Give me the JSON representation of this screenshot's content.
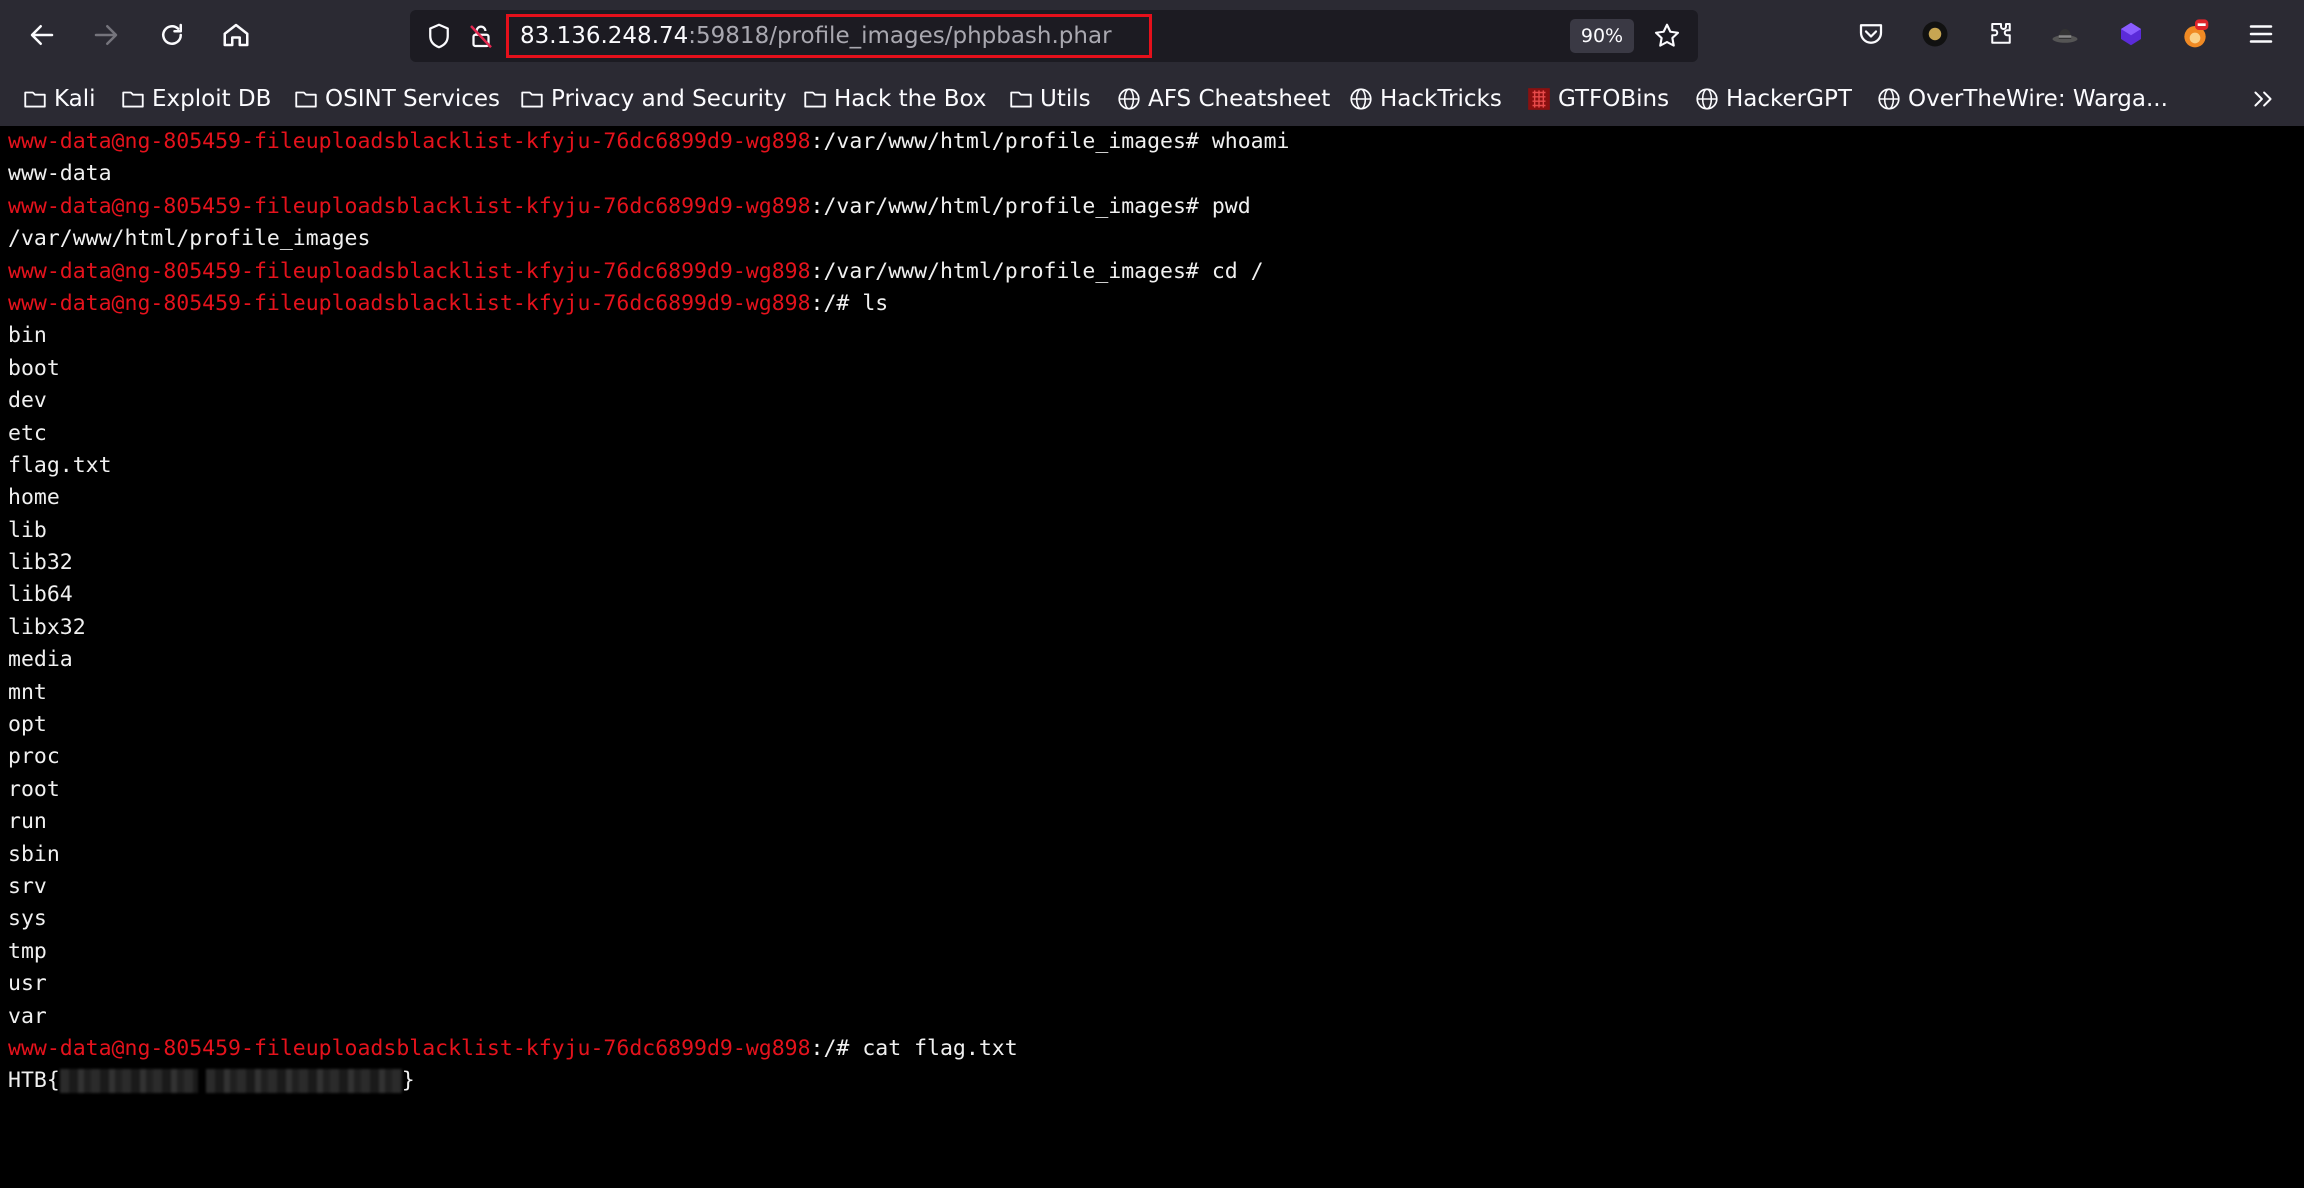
{
  "browser": {
    "url_host": "83.136.248.74",
    "url_rest": ":59818/profile_images/phpbash.phar",
    "zoom": "90%"
  },
  "bookmarks": [
    {
      "label": "Kali",
      "icon": "folder-icon"
    },
    {
      "label": "Exploit DB",
      "icon": "folder-icon"
    },
    {
      "label": "OSINT Services",
      "icon": "folder-icon"
    },
    {
      "label": "Privacy and Security",
      "icon": "folder-icon"
    },
    {
      "label": "Hack the Box",
      "icon": "folder-icon"
    },
    {
      "label": "Utils",
      "icon": "folder-icon"
    },
    {
      "label": "AFS Cheatsheet",
      "icon": "globe-icon"
    },
    {
      "label": "HackTricks",
      "icon": "globe-icon"
    },
    {
      "label": "GTFOBins",
      "icon": "gtfobins-icon"
    },
    {
      "label": "HackerGPT",
      "icon": "globe-icon"
    },
    {
      "label": "OverTheWire: Warga...",
      "icon": "globe-icon"
    }
  ],
  "terminal": {
    "prompt_user": "www-data@ng-805459-fileuploadsblacklist-kfyju-76dc6899d9-wg898",
    "lines": [
      {
        "type": "prompt",
        "path": ":/var/www/html/profile_images# ",
        "cmd": "whoami"
      },
      {
        "type": "output",
        "text": "www-data"
      },
      {
        "type": "prompt",
        "path": ":/var/www/html/profile_images# ",
        "cmd": "pwd"
      },
      {
        "type": "output",
        "text": "/var/www/html/profile_images"
      },
      {
        "type": "prompt",
        "path": ":/var/www/html/profile_images# ",
        "cmd": "cd /"
      },
      {
        "type": "prompt",
        "path": ":/# ",
        "cmd": "ls"
      },
      {
        "type": "output",
        "text": "bin"
      },
      {
        "type": "output",
        "text": "boot"
      },
      {
        "type": "output",
        "text": "dev"
      },
      {
        "type": "output",
        "text": "etc"
      },
      {
        "type": "output",
        "text": "flag.txt"
      },
      {
        "type": "output",
        "text": "home"
      },
      {
        "type": "output",
        "text": "lib"
      },
      {
        "type": "output",
        "text": "lib32"
      },
      {
        "type": "output",
        "text": "lib64"
      },
      {
        "type": "output",
        "text": "libx32"
      },
      {
        "type": "output",
        "text": "media"
      },
      {
        "type": "output",
        "text": "mnt"
      },
      {
        "type": "output",
        "text": "opt"
      },
      {
        "type": "output",
        "text": "proc"
      },
      {
        "type": "output",
        "text": "root"
      },
      {
        "type": "output",
        "text": "run"
      },
      {
        "type": "output",
        "text": "sbin"
      },
      {
        "type": "output",
        "text": "srv"
      },
      {
        "type": "output",
        "text": "sys"
      },
      {
        "type": "output",
        "text": "tmp"
      },
      {
        "type": "output",
        "text": "usr"
      },
      {
        "type": "output",
        "text": "var"
      },
      {
        "type": "prompt",
        "path": ":/# ",
        "cmd": "cat flag.txt"
      },
      {
        "type": "flag",
        "prefix": "HTB{",
        "suffix": "}"
      }
    ]
  }
}
